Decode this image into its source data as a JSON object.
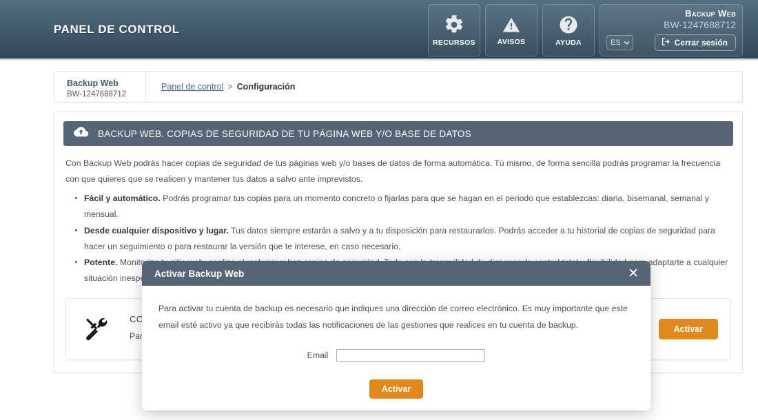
{
  "header": {
    "title": "PANEL DE CONTROL",
    "tiles": [
      {
        "label": "RECURSOS",
        "icon": "gear-icon"
      },
      {
        "label": "AVISOS",
        "icon": "warning-triangle-icon"
      },
      {
        "label": "AYUDA",
        "icon": "question-circle-icon"
      }
    ],
    "account": {
      "name": "Backup Web",
      "id": "BW-1247688712",
      "language": "ES",
      "logout_label": "Cerrar sesión"
    },
    "colors": {
      "gradient_top": "#536f81",
      "gradient_bottom": "#2f4657"
    }
  },
  "breadcrumb": {
    "account_name": "Backup Web",
    "account_id": "BW-1247688712",
    "link": "Panel de control",
    "separator": ">",
    "current": "Configuración"
  },
  "panel": {
    "heading": "BACKUP WEB. COPIAS DE SEGURIDAD DE TU PÁGINA WEB Y/O BASE DE DATOS",
    "heading_icon": "cloud-upload-icon",
    "lede": "Con Backup Web podrás hacer copias de seguridad de tus páginas web y/o bases de datos de forma automática. Tú mismo, de forma sencilla podrás programar la frecuencia con que quieres que se realicen y mantener tus datos a salvo ante imprevistos.",
    "features": [
      {
        "bold": "Fácil y automático.",
        "rest": " Podrás programar tus copias para un momento concreto o fijarlas para que se hagan en el periodo que establezcas: diaria, bisemanal, semanal y mensual."
      },
      {
        "bold": "Desde cualquier dispositivo y lugar.",
        "rest": " Tus datos siempre estarán a salvo y a tu disposición para restaurarlos. Podrás acceder a tu historial de copias de seguridad para hacer un seguimiento o para restaurar la versión que te interese, en caso necesario."
      },
      {
        "bold": "Potente.",
        "rest": " Monitoriza tu sitio web, analiza el malware y haz copias de seguridad. Todo con la tranquilidad de disponer de control total y flexibilidad para adaptarte a cualquier situación inesperada."
      }
    ]
  },
  "config_card": {
    "icon": "tools-icon",
    "title": "CONFIGURACIÓN",
    "description": "Para empezar a utilizar tu servicio de Backup Web debes activarlo y configurar tus copias de seguridad.",
    "action_label": "Activar"
  },
  "modal": {
    "title": "Activar Backup Web",
    "close_icon": "close-icon",
    "body": "Para activar tu cuenta de backup es necesario que indiques una dirección de correo electrónico. Es muy importante que este email esté activo ya que recibirás todas las notificaciones de las gestiones que realices en tu cuenta de backup.",
    "email_label": "Email",
    "email_value": "",
    "email_placeholder": "",
    "submit_label": "Activar"
  },
  "theme": {
    "slate": "#556576",
    "orange": "#e08a1e",
    "link_blue": "#4a6a86",
    "body_text": "#4e5154"
  }
}
